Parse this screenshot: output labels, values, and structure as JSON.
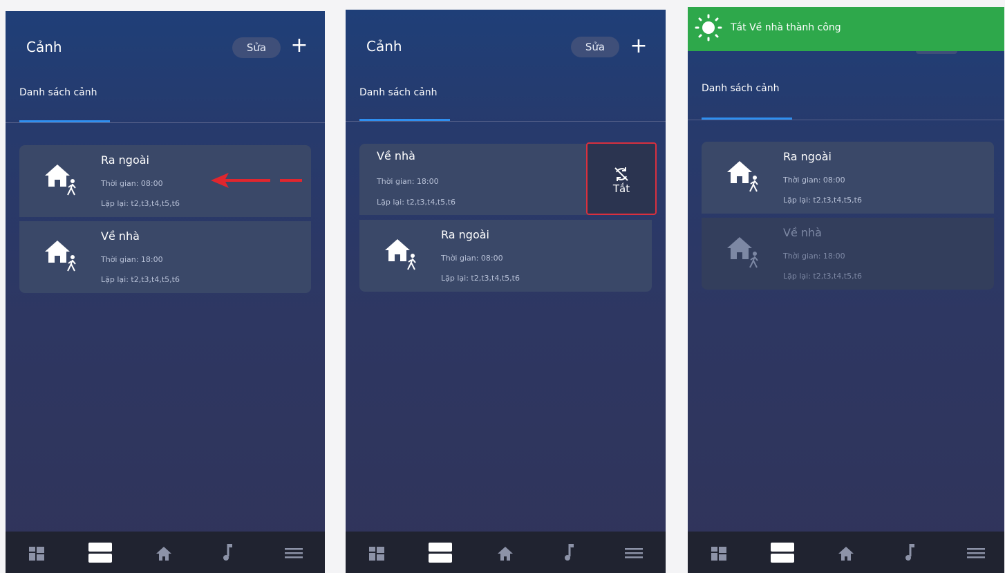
{
  "screens": [
    {
      "header": {
        "title": "Cảnh",
        "edit_label": "Sửa",
        "add_label": "+"
      },
      "tab": "Danh sách cảnh",
      "scenes": [
        {
          "name": "Ra ngoài",
          "time": "Thời gian: 08:00",
          "repeat": "Lặp lại: t2,t3,t4,t5,t6"
        },
        {
          "name": "Về nhà",
          "time": "Thời gian: 18:00",
          "repeat": "Lặp lại: t2,t3,t4,t5,t6"
        }
      ]
    },
    {
      "header": {
        "title": "Cảnh",
        "edit_label": "Sửa",
        "add_label": "+"
      },
      "tab": "Danh sách cảnh",
      "scenes": [
        {
          "name": "Về nhà",
          "time": "Thời gian: 18:00",
          "repeat": "Lặp lại: t2,t3,t4,t5,t6"
        },
        {
          "name": "Ra ngoài",
          "time": "Thời gian: 08:00",
          "repeat": "Lặp lại: t2,t3,t4,t5,t6"
        }
      ],
      "swipe_action": {
        "label": "Tắt",
        "icon": "sync-off-icon"
      }
    },
    {
      "toast": {
        "message": "Tắt Về nhà thành công",
        "icon": "sun-icon"
      },
      "tab": "Danh sách cảnh",
      "scenes": [
        {
          "name": "Ra ngoài",
          "time": "Thời gian: 08:00",
          "repeat": "Lặp lại: t2,t3,t4,t5,t6"
        },
        {
          "name": "Về nhà",
          "time": "Thời gian: 18:00",
          "repeat": "Lặp lại: t2,t3,t4,t5,t6",
          "state": "disabled"
        }
      ]
    }
  ],
  "bottom_nav": [
    "dashboard-icon",
    "scenes-icon",
    "home-icon",
    "music-icon",
    "menu-icon"
  ],
  "colors": {
    "accent": "#2f8ff0",
    "toast": "#2ea84b",
    "highlight": "#d9303e",
    "swipe_arrow": "#e0262e"
  }
}
